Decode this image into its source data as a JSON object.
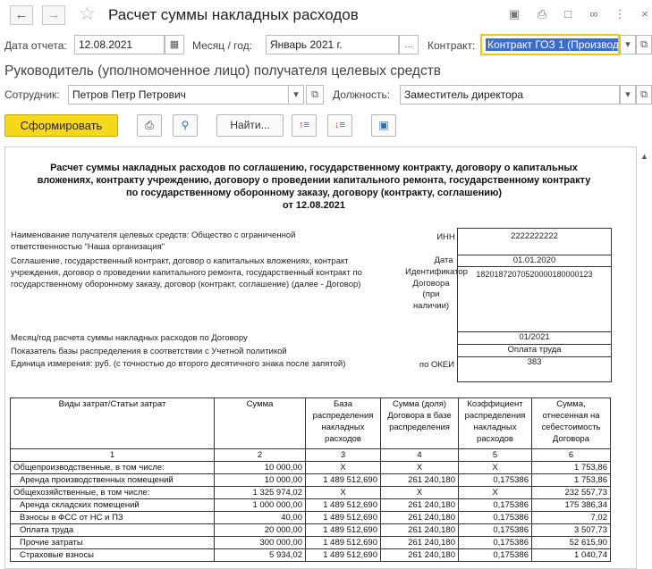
{
  "window": {
    "title": "Расчет суммы накладных расходов",
    "icons": [
      "save-icon",
      "print-icon",
      "preview-icon",
      "link-icon",
      "more-icon",
      "close-icon"
    ]
  },
  "filters": {
    "date_label": "Дата отчета:",
    "date_value": "12.08.2021",
    "month_label": "Месяц / год:",
    "month_value": "Январь 2021 г.",
    "month_btn": "...",
    "contract_label": "Контракт:",
    "contract_value": "Контракт ГОЗ 1 (Производ"
  },
  "section_title": "Руководитель (уполномоченное лицо) получателя целевых средств",
  "employee": {
    "label": "Сотрудник:",
    "value": "Петров Петр Петрович",
    "position_label": "Должность:",
    "position_value": "Заместитель директора"
  },
  "toolbar": {
    "generate": "Сформировать",
    "find": "Найти..."
  },
  "report": {
    "title": "Расчет суммы накладных расходов по соглашению, государственному контракту, договору о капитальных вложениях, контракту учреждению, договору о проведении капитального ремонта, государственному контракту по государственному оборонному заказу, договору (контракту, соглашению)",
    "date_line": "от 12.08.2021",
    "recipient_text": "Наименование получателя целевых средств: Общество с ограниченной ответственностью \"Наша организация\"",
    "agreement_text": "Соглашение, государственный контракт, договор о капитальных вложениях, контракт учреждения, договор о проведении капитального ремонта, государственный контракт по государственному оборонному заказу, договор (контракт, соглашение) (далее - Договор)",
    "inn_label": "ИНН",
    "inn_value": "2222222222",
    "date_label": "Дата",
    "date_value": "01.01.2020",
    "id_label": "Идентификатор Договора (при наличии)",
    "id_value": "18201872070520000180000123",
    "period_text": "Месяц/год расчета суммы накладных расходов по Договору",
    "period_value": "01/2021",
    "base_text": "Показатель базы распределения в соответствии с Учетной политикой",
    "base_value": "Оплата труда",
    "unit_text": "Единица измерения: руб. (с точностью до второго десятичного знака после запятой)",
    "okei_label": "по ОКЕИ",
    "okei_value": "383",
    "columns": [
      "Виды затрат/Статьи затрат",
      "Сумма",
      "База распределения накладных расходов",
      "Сумма (доля) Договора в базе распределения",
      "Коэффициент распределения накладных расходов",
      "Сумма, отнесенная на себестоимость Договора"
    ],
    "col_numbers": [
      "1",
      "2",
      "3",
      "4",
      "5",
      "6"
    ],
    "rows": [
      {
        "name": "Общепроизводственные, в том числе:",
        "sum": "10 000,00",
        "base": "X",
        "share": "X",
        "coef": "X",
        "total": "1 753,86",
        "indent": false
      },
      {
        "name": "Аренда производственных помещений",
        "sum": "10 000,00",
        "base": "1 489 512,690",
        "share": "261 240,180",
        "coef": "0,175386",
        "total": "1 753,86",
        "indent": true
      },
      {
        "name": "Общехозяйственные, в том числе:",
        "sum": "1 325 974,02",
        "base": "X",
        "share": "X",
        "coef": "X",
        "total": "232 557,73",
        "indent": false
      },
      {
        "name": "Аренда складских помещений",
        "sum": "1 000 000,00",
        "base": "1 489 512,690",
        "share": "261 240,180",
        "coef": "0,175386",
        "total": "175 386,34",
        "indent": true
      },
      {
        "name": "Взносы в ФСС от НС и ПЗ",
        "sum": "40,00",
        "base": "1 489 512,690",
        "share": "261 240,180",
        "coef": "0,175386",
        "total": "7,02",
        "indent": true
      },
      {
        "name": "Оплата труда",
        "sum": "20 000,00",
        "base": "1 489 512,690",
        "share": "261 240,180",
        "coef": "0,175386",
        "total": "3 507,73",
        "indent": true
      },
      {
        "name": "Прочие затраты",
        "sum": "300 000,00",
        "base": "1 489 512,690",
        "share": "261 240,180",
        "coef": "0,175386",
        "total": "52 615,90",
        "indent": true
      },
      {
        "name": "Страховые взносы",
        "sum": "5 934,02",
        "base": "1 489 512,690",
        "share": "261 240,180",
        "coef": "0,175386",
        "total": "1 040,74",
        "indent": true
      }
    ]
  }
}
